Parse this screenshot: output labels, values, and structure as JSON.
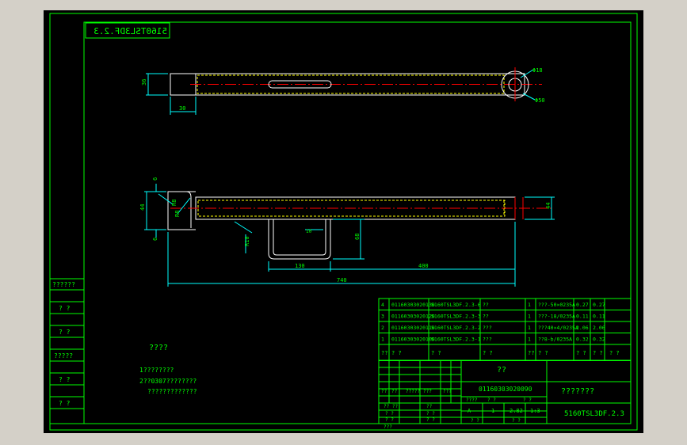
{
  "colors": {
    "background": "#d4d0c8",
    "paper": "#000000",
    "border": "#00ff00",
    "outline": "#ffffff",
    "hidden": "#ffff00",
    "center": "#ff0000",
    "dimension": "#00ffff",
    "text": "#00ff00"
  },
  "drawing_code_mirrored": "5160TSL3DF.2.3",
  "top_view": {
    "dim_height": "36",
    "dim_end": "30",
    "dim_hole": "Φ18",
    "dim_circle": "Φ50"
  },
  "front_view": {
    "dim_t1": "6",
    "dim_r1": "R8",
    "dim_r2": "R8",
    "dim_total_h": "44",
    "dim_t2": "6",
    "dim_right": "44",
    "dim_r_bottom": "R10",
    "dim_leg_gap": "130",
    "dim_leg_h": "68",
    "dim_small": "10",
    "dim_right_span": "400",
    "dim_overall": "740"
  },
  "left_labels": [
    "??????",
    "? ?",
    "? ?",
    "?????",
    "? ?",
    "? ?"
  ],
  "notes": {
    "heading": "????",
    "line1": "1????????",
    "line2": "2??0307????????",
    "line3": "?????????????"
  },
  "bom": {
    "rows": [
      {
        "no": "4",
        "code": "01160303020130",
        "name": "5160TSL3DF.2.3-6",
        "desc": "??",
        "qty": "1",
        "material": "???-50×0235A",
        "unit_w": "0.27",
        "total_w": "0.27"
      },
      {
        "no": "3",
        "code": "01160303020120",
        "name": "5160TSL3DF.2.3-3",
        "desc": "??",
        "qty": "1",
        "material": "???-18/0235A",
        "unit_w": "0.11",
        "total_w": "0.11"
      },
      {
        "no": "2",
        "code": "01160303020110",
        "name": "5160TSL3DF.2.3-2",
        "desc": "???",
        "qty": "1",
        "material": "???40×4/0235A",
        "unit_w": "2.06",
        "total_w": "2.06"
      },
      {
        "no": "1",
        "code": "01160303020100",
        "name": "5160TSL3DF.2.3-1",
        "desc": "???",
        "qty": "1",
        "material": "??8-b/0235A",
        "unit_w": "0.32",
        "total_w": "0.32"
      }
    ],
    "header": {
      "no": "??",
      "code": "? ?",
      "name": "? ?",
      "desc": "? ?",
      "qty": "??",
      "material": "? ?",
      "unit_w": "? ?",
      "total_w": "? ?",
      "weight_top": "? ?",
      "weight_bottom": "? ?",
      "note": "? ?"
    }
  },
  "title_block": {
    "unit": "??",
    "part_code": "01160303020090",
    "part_name": "???????",
    "drawing_no": "5160TSL3DF.2.3",
    "row_labels": [
      "?? ??",
      "????",
      "? ?",
      "? ?",
      "???"
    ],
    "small_left": [
      "??",
      "??"
    ],
    "sign_cells": [
      "??",
      "?????",
      "???",
      "???",
      "???"
    ],
    "stage_labels": [
      "????",
      "? ?",
      "? ?"
    ],
    "stage": "A",
    "scale": "1",
    "weight": "2.82",
    "sheet": "1:3",
    "sheet_labels": [
      "? ?",
      "? ?"
    ]
  }
}
